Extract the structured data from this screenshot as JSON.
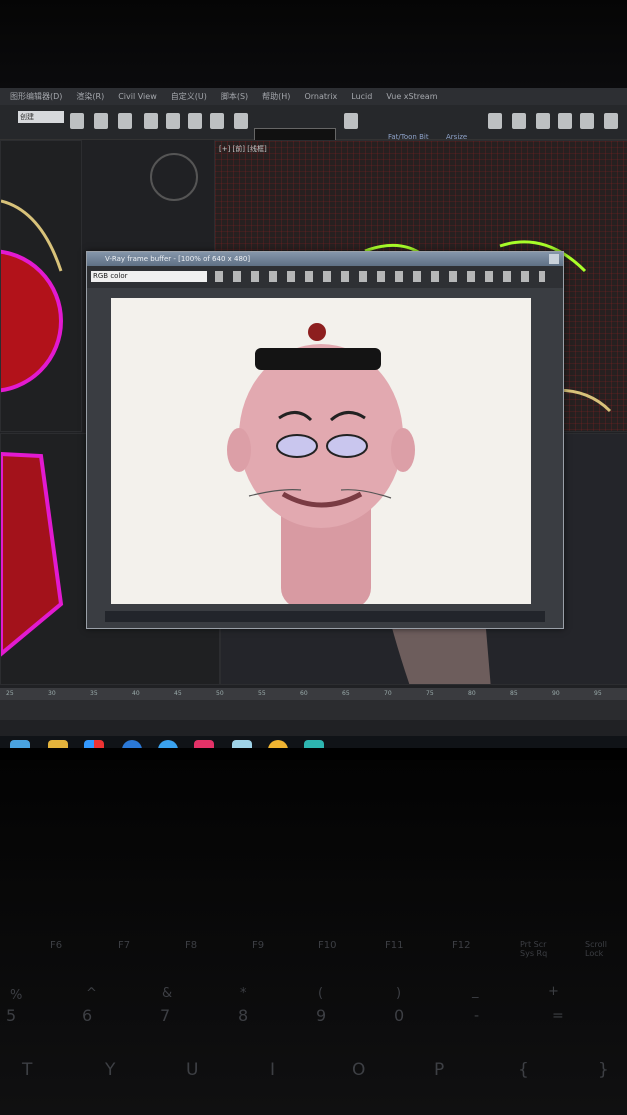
{
  "menu": [
    "图形编辑器(D)",
    "渲染(R)",
    "Civil View",
    "自定义(U)",
    "脚本(S)",
    "帮助(H)",
    "Ornatrix",
    "Lucid",
    "Vue xStream"
  ],
  "toolbar": {
    "selection_set": "创建",
    "fields": [
      "Fat/Toon Bit",
      "Arsize"
    ]
  },
  "viewport_label": "[+] [前] [线框]",
  "vfb": {
    "title": "V-Ray frame buffer - [100% of 640 x 480]",
    "channel": "RGB color"
  },
  "timeline_ticks": [
    "25",
    "30",
    "35",
    "40",
    "45",
    "50",
    "55",
    "60",
    "65",
    "70",
    "75",
    "80",
    "85",
    "90",
    "95"
  ],
  "keyboard": {
    "fn_keys": [
      "F6",
      "F7",
      "F8",
      "F9",
      "F10",
      "F11",
      "F12",
      "Prt Scr Sys Rq",
      "Scroll Lock"
    ],
    "num_row": [
      "5",
      "6",
      "7",
      "8",
      "9",
      "0",
      "-",
      "="
    ],
    "shift_row": [
      "%",
      "^",
      "&",
      "*",
      "(",
      ")",
      "_",
      "+"
    ],
    "letter_row": [
      "T",
      "Y",
      "U",
      "I",
      "O",
      "P",
      "{",
      "}"
    ]
  },
  "colors": {
    "screen": "#202124",
    "render_bg": "#f3f1ec",
    "skin": "#e2a9b0",
    "hat": "#141414",
    "wire_red": "#c4141a",
    "wire_magenta": "#e21ad0"
  }
}
